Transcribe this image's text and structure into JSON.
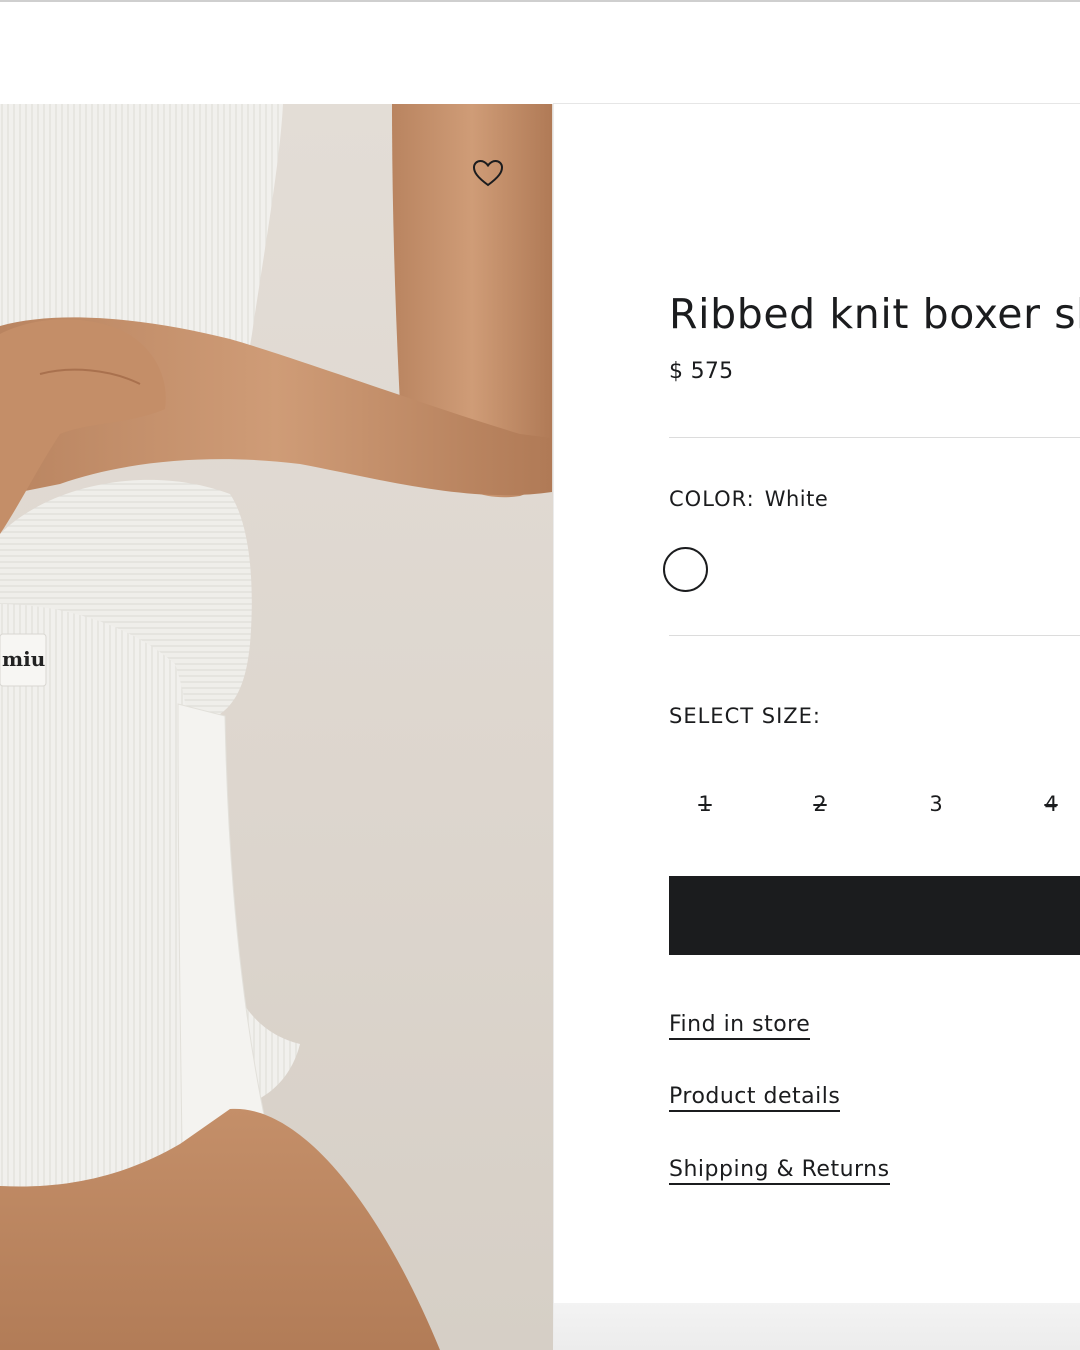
{
  "product": {
    "title": "Ribbed knit boxer shorts",
    "price": "$ 575",
    "image_alt": "Model wearing white ribbed knit tank and boxer shorts",
    "label_text": "miu",
    "wishlist_icon": "heart-outline-icon"
  },
  "color": {
    "label": "COLOR:",
    "selected": "White",
    "swatches": [
      {
        "name": "White",
        "hex": "#ffffff",
        "selected": true
      }
    ]
  },
  "size": {
    "label": "SELECT SIZE:",
    "options": [
      {
        "label": "1",
        "available": false
      },
      {
        "label": "2",
        "available": false
      },
      {
        "label": "3",
        "available": true
      },
      {
        "label": "4",
        "available": false
      }
    ]
  },
  "actions": {
    "add_to_bag_label": ""
  },
  "links": {
    "find_in_store": "Find in store",
    "product_details": "Product details",
    "shipping_returns": "Shipping & Returns"
  },
  "colors": {
    "text": "#1b1c1e",
    "button": "#1b1c1e",
    "divider": "#dcdcdc",
    "image_background": "#ddd6ce",
    "skin": "#c9956f",
    "garment": "#f1f0ed"
  }
}
